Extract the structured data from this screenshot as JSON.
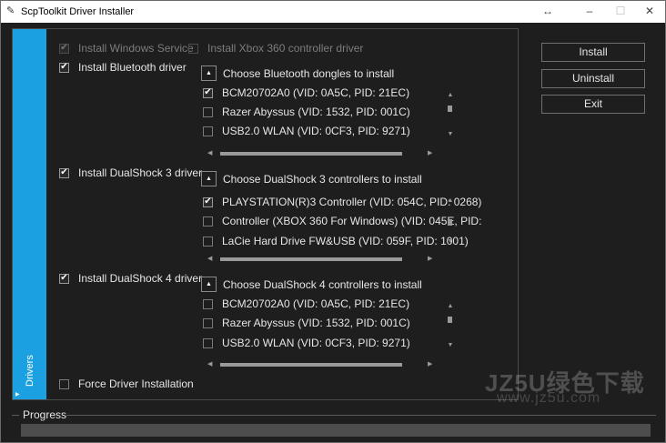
{
  "window": {
    "title": "ScpToolkit Driver Installer"
  },
  "tab": {
    "label": "Drivers"
  },
  "options": {
    "install_windows_service": {
      "label": "Install Windows Service",
      "checked": true,
      "enabled": false
    },
    "install_xbox360_driver": {
      "label": "Install Xbox 360 controller driver",
      "checked": false,
      "enabled": false
    },
    "install_bluetooth_driver": {
      "label": "Install Bluetooth driver",
      "checked": true
    },
    "install_ds3_driver": {
      "label": "Install DualShock 3 driver",
      "checked": true
    },
    "install_ds4_driver": {
      "label": "Install DualShock 4 driver",
      "checked": true
    },
    "force_driver_installation": {
      "label": "Force Driver Installation",
      "checked": false
    }
  },
  "groups": {
    "bluetooth": {
      "header": "Choose Bluetooth dongles to install",
      "items": [
        {
          "label": "BCM20702A0 (VID: 0A5C, PID: 21EC)",
          "checked": true
        },
        {
          "label": "Razer Abyssus (VID: 1532, PID: 001C)",
          "checked": false
        },
        {
          "label": "USB2.0 WLAN (VID: 0CF3, PID: 9271)",
          "checked": false
        }
      ]
    },
    "ds3": {
      "header": "Choose DualShock 3 controllers to install",
      "items": [
        {
          "label": "PLAYSTATION(R)3 Controller (VID: 054C, PID: 0268)",
          "checked": true
        },
        {
          "label": "Controller (XBOX 360 For Windows) (VID: 045E, PID:",
          "checked": false
        },
        {
          "label": "LaCie Hard Drive FW&USB (VID: 059F, PID: 1001)",
          "checked": false
        }
      ]
    },
    "ds4": {
      "header": "Choose DualShock 4 controllers to install",
      "items": [
        {
          "label": "BCM20702A0 (VID: 0A5C, PID: 21EC)",
          "checked": false
        },
        {
          "label": "Razer Abyssus (VID: 1532, PID: 001C)",
          "checked": false
        },
        {
          "label": "USB2.0 WLAN (VID: 0CF3, PID: 9271)",
          "checked": false
        }
      ]
    }
  },
  "buttons": {
    "install": "Install",
    "uninstall": "Uninstall",
    "exit": "Exit"
  },
  "progress": {
    "label": "Progress",
    "value": 0
  },
  "watermark": {
    "text": "JZ5U绿色下载",
    "url": "www.jz5u.com"
  },
  "icons": {
    "check": "✔",
    "collapse": "▲",
    "up": "▲",
    "down": "▼",
    "left": "◀",
    "right": "▶"
  },
  "colors": {
    "accent": "#1ba1e2",
    "background": "#1e1e1e",
    "text": "#e6e6e6"
  }
}
